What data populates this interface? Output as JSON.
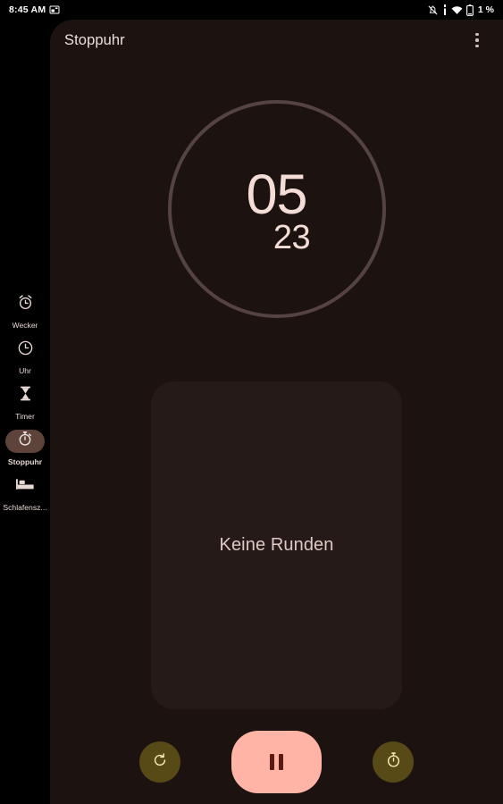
{
  "status_bar": {
    "clock": "8:45 AM",
    "left_icons": [
      {
        "name": "screenshot-icon"
      }
    ],
    "right_icons": [
      {
        "name": "ringer-muted-icon"
      },
      {
        "name": "cellular-signal-icon"
      },
      {
        "name": "wifi-icon"
      },
      {
        "name": "battery-icon"
      }
    ],
    "battery_percent": "1 %"
  },
  "nav_rail": {
    "items": [
      {
        "label": "Wecker",
        "icon": "alarm-clock-icon",
        "selected": false
      },
      {
        "label": "Uhr",
        "icon": "clock-icon",
        "selected": false
      },
      {
        "label": "Timer",
        "icon": "hourglass-icon",
        "selected": false
      },
      {
        "label": "Stoppuhr",
        "icon": "stopwatch-icon",
        "selected": true
      },
      {
        "label": "Schlafensz...",
        "icon": "bed-icon",
        "selected": false
      }
    ]
  },
  "app_bar": {
    "title": "Stoppuhr",
    "overflow_label": "more-options"
  },
  "stopwatch": {
    "seconds": "05",
    "hundredths": "23"
  },
  "laps": {
    "empty_text": "Keine Runden",
    "entries": []
  },
  "controls": {
    "reset": {
      "label": "reset",
      "icon": "refresh-icon"
    },
    "play_pause": {
      "label": "pause",
      "icon": "pause-icon",
      "state": "running"
    },
    "lap": {
      "label": "lap",
      "icon": "stopwatch-icon"
    }
  },
  "colors": {
    "rail_background": "#000000",
    "panel_background": "#1C1311",
    "card_background": "#261A18",
    "dial_ring": "#544340",
    "accent_pink": "#FFB4A6",
    "accent_pink_on": "#5C1A12",
    "secondary_button": "#574A17",
    "selected_pill": "#5D4339",
    "text_primary": "#EDE0DC",
    "text_timer": "#F4DDD7"
  }
}
